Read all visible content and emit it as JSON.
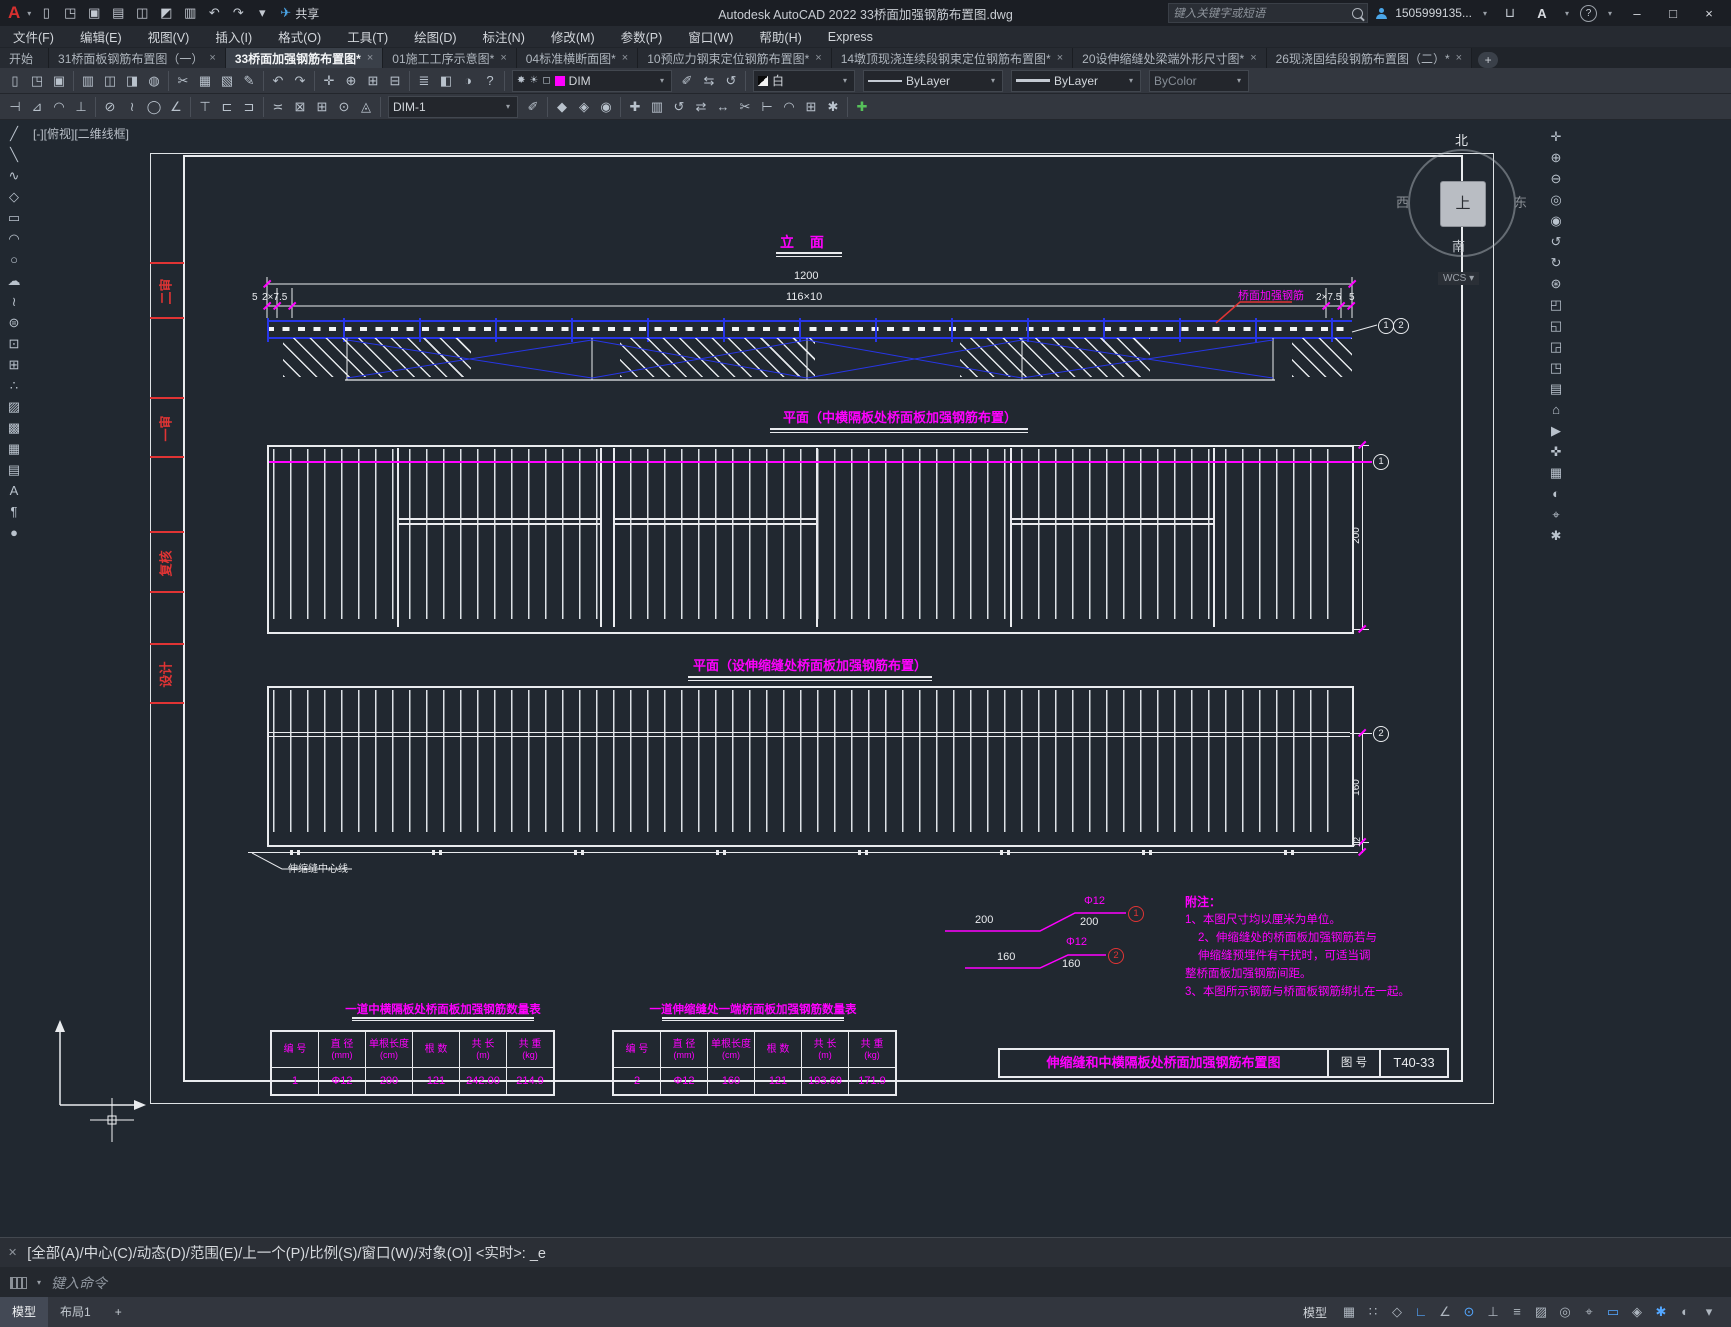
{
  "window": {
    "title": "Autodesk AutoCAD 2022    33桥面加强钢筋布置图.dwg",
    "share_label": "共享",
    "search_placeholder": "键入关键字或短语",
    "user": "1505999135...",
    "minimize": "–",
    "maximize": "□",
    "close": "×",
    "logo": "A",
    "help_glyph": "?",
    "cart_glyph": "⊔",
    "apps_glyph": "A"
  },
  "menus": [
    "文件(F)",
    "编辑(E)",
    "视图(V)",
    "插入(I)",
    "格式(O)",
    "工具(T)",
    "绘图(D)",
    "标注(N)",
    "修改(M)",
    "参数(P)",
    "窗口(W)",
    "帮助(H)",
    "Express"
  ],
  "qat": [
    {
      "name": "new-file-icon",
      "glyph": "▯"
    },
    {
      "name": "open-file-icon",
      "glyph": "◳"
    },
    {
      "name": "save-icon",
      "glyph": "▣"
    },
    {
      "name": "save-as-icon",
      "glyph": "▤"
    },
    {
      "name": "upload-icon",
      "glyph": "◫"
    },
    {
      "name": "download-icon",
      "glyph": "◩"
    },
    {
      "name": "plot-icon",
      "glyph": "▥"
    },
    {
      "name": "undo-icon",
      "glyph": "↶"
    },
    {
      "name": "redo-icon",
      "glyph": "↷"
    },
    {
      "name": "qat-menu-icon",
      "glyph": "▾"
    }
  ],
  "share_icon": "✈",
  "file_tabs": [
    {
      "label": "开始",
      "x": ""
    },
    {
      "label": "31桥面板钢筋布置图（一）",
      "x": "×"
    },
    {
      "label": "33桥面加强钢筋布置图*",
      "x": "×",
      "active": true
    },
    {
      "label": "01施工工序示意图*",
      "x": "×"
    },
    {
      "label": "04标准横断面图*",
      "x": "×"
    },
    {
      "label": "10预应力钢束定位钢筋布置图*",
      "x": "×"
    },
    {
      "label": "14墩顶现浇连续段钢束定位钢筋布置图*",
      "x": "×"
    },
    {
      "label": "20设伸缩缝处梁端外形尺寸图*",
      "x": "×"
    },
    {
      "label": "26现浇固结段钢筋布置图（二）*",
      "x": "×"
    }
  ],
  "new_tab_button": "+",
  "toolbar1": {
    "icons": [
      {
        "name": "qnew-icon",
        "glyph": "▯"
      },
      {
        "name": "open-icon",
        "glyph": "◳"
      },
      {
        "name": "save-icon",
        "glyph": "▣"
      },
      {
        "sep": true
      },
      {
        "name": "plot-icon",
        "glyph": "▥"
      },
      {
        "name": "plot-preview-icon",
        "glyph": "◫"
      },
      {
        "name": "publish-icon",
        "glyph": "◨"
      },
      {
        "name": "web-icon",
        "glyph": "◍"
      },
      {
        "sep": true
      },
      {
        "name": "cut-icon",
        "glyph": "✂"
      },
      {
        "name": "copy-icon",
        "glyph": "▦"
      },
      {
        "name": "paste-icon",
        "glyph": "▧"
      },
      {
        "name": "match-properties-icon",
        "glyph": "✎"
      },
      {
        "sep": true
      },
      {
        "name": "undo-icon",
        "glyph": "↶"
      },
      {
        "name": "redo-icon",
        "glyph": "↷"
      },
      {
        "sep": true
      },
      {
        "name": "pan-icon",
        "glyph": "✛"
      },
      {
        "name": "zoom-realtime-icon",
        "glyph": "⊕"
      },
      {
        "name": "zoom-window-icon",
        "glyph": "⊞"
      },
      {
        "name": "zoom-previous-icon",
        "glyph": "⊟"
      },
      {
        "sep": true
      },
      {
        "name": "layer-properties-icon",
        "glyph": "≣"
      },
      {
        "name": "layer-states-icon",
        "glyph": "◧"
      },
      {
        "name": "layer-isolate-icon",
        "glyph": "◑"
      },
      {
        "name": "help-icon",
        "glyph": "?"
      },
      {
        "sep": true
      }
    ],
    "layer_combo": {
      "bulb": "✸",
      "sun": "☀",
      "lock": "◻",
      "value": "DIM",
      "swatch": "#ff00ff",
      "caret": "▾"
    },
    "icons2": [
      {
        "name": "make-layer-current-icon",
        "glyph": "✐"
      },
      {
        "name": "layer-match-icon",
        "glyph": "⇆"
      },
      {
        "name": "layer-previous-icon",
        "glyph": "↺"
      }
    ],
    "color_combo": {
      "value": "白",
      "caret": "▾"
    },
    "linetype_combo": {
      "value": "ByLayer",
      "caret": "▾"
    },
    "lineweight_combo": {
      "value": "ByLayer",
      "caret": "▾"
    },
    "plotstyle_combo": {
      "value": "ByColor",
      "caret": "▾"
    }
  },
  "toolbar2": {
    "icons": [
      {
        "name": "dim-linear-icon",
        "glyph": "⊣"
      },
      {
        "name": "dim-aligned-icon",
        "glyph": "⊿"
      },
      {
        "name": "dim-arc-icon",
        "glyph": "◠"
      },
      {
        "name": "dim-ordinate-icon",
        "glyph": "⊥"
      },
      {
        "sep": true
      },
      {
        "name": "dim-radius-icon",
        "glyph": "⊘"
      },
      {
        "name": "dim-jogged-icon",
        "glyph": "≀"
      },
      {
        "name": "dim-diameter-icon",
        "glyph": "◯"
      },
      {
        "name": "dim-angular-icon",
        "glyph": "∠"
      },
      {
        "sep": true
      },
      {
        "name": "dim-quick-icon",
        "glyph": "⊤"
      },
      {
        "name": "dim-baseline-icon",
        "glyph": "⊏"
      },
      {
        "name": "dim-continue-icon",
        "glyph": "⊐"
      },
      {
        "sep": true
      },
      {
        "name": "dim-space-icon",
        "glyph": "≍"
      },
      {
        "name": "dim-break-icon",
        "glyph": "⊠"
      },
      {
        "name": "tolerance-icon",
        "glyph": "⊞"
      },
      {
        "name": "center-mark-icon",
        "glyph": "⊙"
      },
      {
        "name": "dim-inspect-icon",
        "glyph": "◬"
      },
      {
        "sep": true
      }
    ],
    "dimstyle_combo": {
      "value": "DIM-1",
      "caret": "▾"
    },
    "icons2": [
      {
        "name": "dim-update-icon",
        "glyph": "✐"
      },
      {
        "sep": true
      },
      {
        "name": "solid-box-icon",
        "glyph": "◆"
      },
      {
        "name": "solid-cone-icon",
        "glyph": "◈"
      },
      {
        "name": "solid-sphere-icon",
        "glyph": "◉"
      },
      {
        "sep": true
      },
      {
        "name": "move-icon",
        "glyph": "✚"
      },
      {
        "name": "copy-object-icon",
        "glyph": "▥"
      },
      {
        "name": "rotate-icon",
        "glyph": "↺"
      },
      {
        "name": "mirror-icon",
        "glyph": "⇄"
      },
      {
        "name": "stretch-icon",
        "glyph": "↔"
      },
      {
        "name": "trim-icon",
        "glyph": "✂"
      },
      {
        "name": "extend-icon",
        "glyph": "⊢"
      },
      {
        "name": "fillet-icon",
        "glyph": "◠"
      },
      {
        "name": "array-icon",
        "glyph": "⊞"
      },
      {
        "name": "explode-icon",
        "glyph": "✱"
      },
      {
        "sep": true
      },
      {
        "name": "add-icon",
        "glyph": "✚",
        "accent": true
      }
    ]
  },
  "side_left": [
    {
      "name": "line-icon",
      "glyph": "╱"
    },
    {
      "name": "construction-line-icon",
      "glyph": "╲"
    },
    {
      "name": "polyline-icon",
      "glyph": "∿"
    },
    {
      "name": "polygon-icon",
      "glyph": "◇"
    },
    {
      "name": "rectangle-icon",
      "glyph": "▭"
    },
    {
      "name": "arc-icon",
      "glyph": "◠"
    },
    {
      "name": "circle-icon",
      "glyph": "○"
    },
    {
      "name": "revision-cloud-icon",
      "glyph": "☁"
    },
    {
      "name": "spline-icon",
      "glyph": "≀"
    },
    {
      "name": "ellipse-icon",
      "glyph": "⊜"
    },
    {
      "name": "insert-block-icon",
      "glyph": "⊡"
    },
    {
      "name": "make-block-icon",
      "glyph": "⊞"
    },
    {
      "name": "point-icon",
      "glyph": "∴"
    },
    {
      "name": "hatch-icon",
      "glyph": "▨"
    },
    {
      "name": "gradient-icon",
      "glyph": "▩"
    },
    {
      "name": "region-icon",
      "glyph": "▦"
    },
    {
      "name": "table-icon",
      "glyph": "▤"
    },
    {
      "name": "text-icon",
      "glyph": "A"
    },
    {
      "name": "mtext-icon",
      "glyph": "¶"
    },
    {
      "name": "point-style-icon",
      "glyph": "●"
    }
  ],
  "side_right": [
    {
      "name": "pan-icon",
      "glyph": "✛"
    },
    {
      "name": "zoom-in-icon",
      "glyph": "⊕"
    },
    {
      "name": "zoom-out-icon",
      "glyph": "⊖"
    },
    {
      "name": "orbit-icon",
      "glyph": "◎"
    },
    {
      "name": "steering-wheel-icon",
      "glyph": "◉"
    },
    {
      "name": "view-back-icon",
      "glyph": "↺"
    },
    {
      "name": "view-forward-icon",
      "glyph": "↻"
    },
    {
      "name": "full-navigation-icon",
      "glyph": "⊛"
    },
    {
      "name": "viewport-1-icon",
      "glyph": "◰"
    },
    {
      "name": "viewport-2-icon",
      "glyph": "◱"
    },
    {
      "name": "viewport-3-icon",
      "glyph": "◲"
    },
    {
      "name": "viewport-4-icon",
      "glyph": "◳"
    },
    {
      "name": "named-views-icon",
      "glyph": "▤"
    },
    {
      "name": "home-view-icon",
      "glyph": "⌂"
    },
    {
      "name": "show-motion-icon",
      "glyph": "▶"
    },
    {
      "name": "ucs-icon",
      "glyph": "✜"
    },
    {
      "name": "grid-display-icon",
      "glyph": "▦"
    },
    {
      "name": "isolate-objects-icon",
      "glyph": "◐"
    },
    {
      "name": "measure-icon",
      "glyph": "⌖"
    },
    {
      "name": "settings-icon",
      "glyph": "✱"
    }
  ],
  "canvas": {
    "viewport_controls": "[-][俯视][二维线框]",
    "viewcube": {
      "n": "北",
      "s": "南",
      "w": "西",
      "e": "东",
      "top": "上",
      "wcs": "WCS",
      "caret": "▾"
    },
    "stamps": [
      "二审",
      "一审",
      "复核",
      "设计"
    ],
    "elevation": {
      "title": "立 面",
      "dim_total": "1200",
      "dim_span": "116×10",
      "dim_l1": "5",
      "dim_l2": "2×7.5",
      "dim_r1": "2×7.5",
      "dim_r2": "5",
      "rebar_label": "桥面加强钢筋",
      "bubble1": "1",
      "bubble2": "2"
    },
    "plan1": {
      "title": "平面（中横隔板处桥面板加强钢筋布置）",
      "dim_right": "200",
      "bubble": "1"
    },
    "plan2": {
      "title": "平面（设伸缩缝处桥面板加强钢筋布置）",
      "dim_right": "160",
      "dim_small": "12",
      "bubble": "2",
      "joint_label": "伸缩缝中心线"
    },
    "detail1": {
      "left": "200",
      "dia": "Φ12",
      "right": "200",
      "bubble": "1"
    },
    "detail2": {
      "left": "160",
      "dia": "Φ12",
      "right": "160",
      "bubble": "2"
    },
    "notes": {
      "title": "附注：",
      "lines": [
        "1、本图尺寸均以厘米为单位。",
        "2、伸缩缝处的桥面板加强钢筋若与",
        "伸缩缝预埋件有干扰时，可适当调",
        "整桥面板加强钢筋间距。",
        "3、本图所示钢筋与桥面板钢筋绑扎在一起。"
      ]
    },
    "titleblock": {
      "title": "伸缩缝和中横隔板处桥面加强钢筋布置图",
      "no_label": "图 号",
      "number": "T40-33"
    },
    "tables": [
      {
        "title": "一道中横隔板处桥面板加强钢筋数量表",
        "headers": [
          [
            "编 号",
            ""
          ],
          [
            "直 径",
            "(mm)"
          ],
          [
            "单根长度",
            "(cm)"
          ],
          [
            "根 数",
            ""
          ],
          [
            "共 长",
            "(m)"
          ],
          [
            "共 重",
            "(kg)"
          ]
        ],
        "row": [
          "1",
          "Φ12",
          "200",
          "121",
          "242.00",
          "214.9"
        ]
      },
      {
        "title": "一道伸缩缝处一端桥面板加强钢筋数量表",
        "headers": [
          [
            "编 号",
            ""
          ],
          [
            "直 径",
            "(mm)"
          ],
          [
            "单根长度",
            "(cm)"
          ],
          [
            "根 数",
            ""
          ],
          [
            "共 长",
            "(m)"
          ],
          [
            "共 重",
            "(kg)"
          ]
        ],
        "row": [
          "2",
          "Φ12",
          "160",
          "121",
          "193.60",
          "171.9"
        ]
      }
    ]
  },
  "command": {
    "close_glyph": "✕",
    "history": "[全部(A)/中心(C)/动态(D)/范围(E)/上一个(P)/比例(S)/窗口(W)/对象(O)] <实时>: _e",
    "prompt": "键入命令",
    "caret": "▾"
  },
  "statusbar": {
    "model_tab": "模型",
    "layout_tab": "布局1",
    "add_tab": "+",
    "model_button": "模型",
    "icons": [
      {
        "name": "grid-icon",
        "glyph": "▦"
      },
      {
        "name": "snap-icon",
        "glyph": "∷"
      },
      {
        "name": "infer-icon",
        "glyph": "◇"
      },
      {
        "name": "ortho-icon",
        "glyph": "∟",
        "active": true
      },
      {
        "name": "polar-icon",
        "glyph": "∠"
      },
      {
        "name": "osnap-icon",
        "glyph": "⊙",
        "active": true
      },
      {
        "name": "otrack-icon",
        "glyph": "⊥"
      },
      {
        "name": "lineweight-icon",
        "glyph": "≡"
      },
      {
        "name": "transparency-icon",
        "glyph": "▨"
      },
      {
        "name": "selection-cycling-icon",
        "glyph": "◎"
      },
      {
        "name": "osnap-3d-icon",
        "glyph": "⌖"
      },
      {
        "name": "dynamic-input-icon",
        "glyph": "▭",
        "active": true
      },
      {
        "name": "annotation-icon",
        "glyph": "◈"
      },
      {
        "name": "workspace-icon",
        "glyph": "✱",
        "active": true
      },
      {
        "name": "isolate-icon",
        "glyph": "◐"
      },
      {
        "name": "customize-icon",
        "glyph": "▾"
      }
    ]
  }
}
